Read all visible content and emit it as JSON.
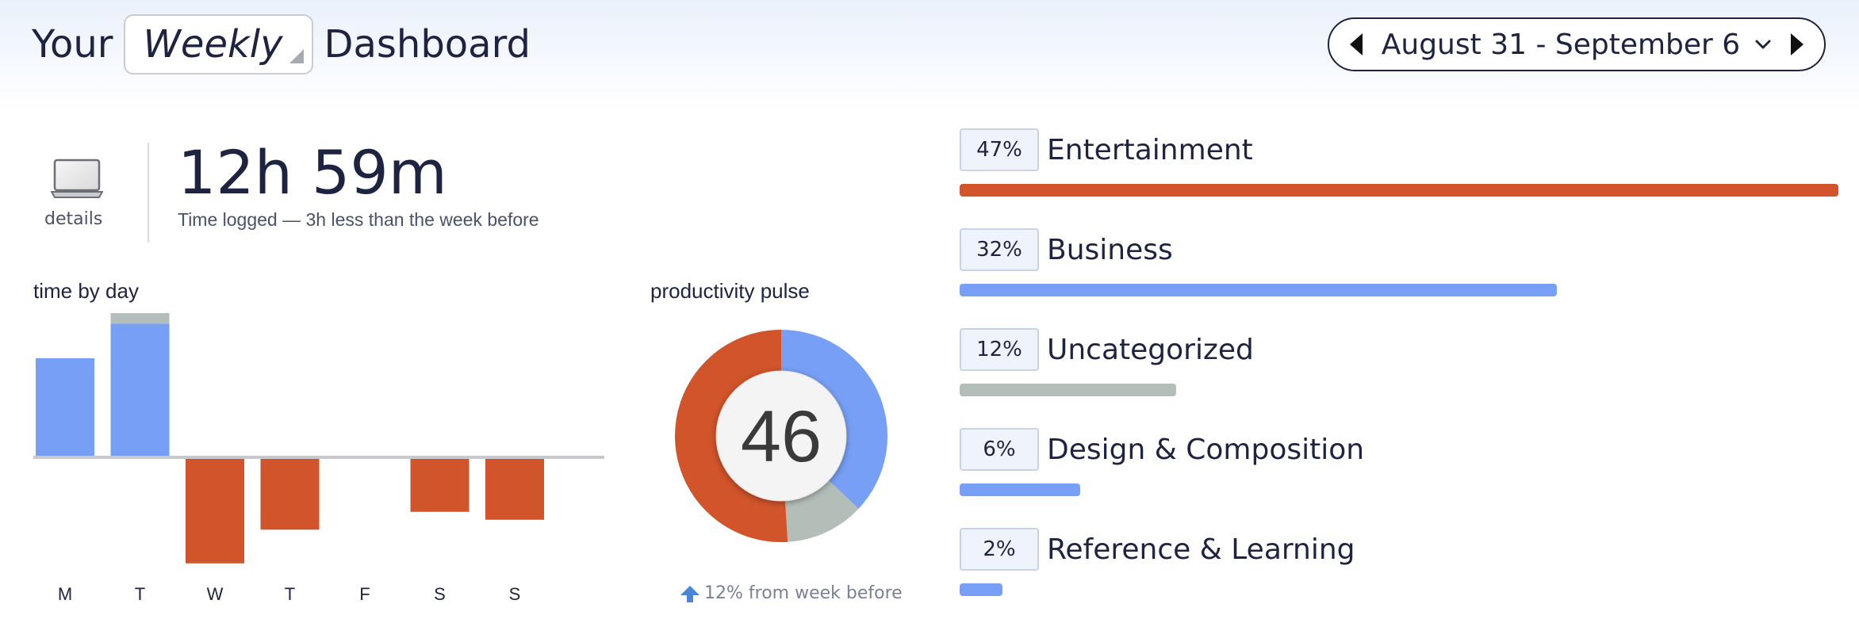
{
  "header": {
    "title_prefix": "Your",
    "period": "Weekly",
    "title_suffix": "Dashboard",
    "date_range": "August 31 - September 6"
  },
  "summary": {
    "details_label": "details",
    "time_logged": "12h 59m",
    "time_note": "Time logged — 3h less than the week before"
  },
  "time_by_day": {
    "title": "time by day",
    "chart_data": {
      "type": "bar",
      "categories": [
        "M",
        "T",
        "W",
        "T",
        "F",
        "S",
        "S"
      ],
      "series": [
        {
          "values": [
            100,
            135,
            0,
            0,
            0,
            0,
            0
          ],
          "color": "#769ff5"
        },
        {
          "values": [
            0,
            35,
            0,
            0,
            0,
            0,
            0
          ],
          "color": "#b4beb9"
        },
        {
          "values": [
            0,
            0,
            -107,
            -73,
            0,
            -55,
            -63
          ],
          "color": "#d1542a"
        }
      ]
    }
  },
  "productivity_pulse": {
    "title": "productivity pulse",
    "score": "46",
    "note": "12% from week before",
    "chart_data": {
      "type": "pie",
      "slices": [
        {
          "value": 37,
          "color": "#769ff5"
        },
        {
          "value": 12,
          "color": "#b4beb9"
        },
        {
          "value": 51,
          "color": "#d1542a"
        }
      ]
    }
  },
  "categories": [
    {
      "percent": "47%",
      "name": "Entertainment",
      "fraction": 1.0,
      "color": "#d1542a"
    },
    {
      "percent": "32%",
      "name": "Business",
      "fraction": 0.68,
      "color": "#769ff5"
    },
    {
      "percent": "12%",
      "name": "Uncategorized",
      "fraction": 0.246,
      "color": "#b4beb9"
    },
    {
      "percent": "6%",
      "name": "Design & Composition",
      "fraction": 0.137,
      "color": "#769ff5"
    },
    {
      "percent": "2%",
      "name": "Reference & Learning",
      "fraction": 0.049,
      "color": "#769ff5"
    }
  ]
}
